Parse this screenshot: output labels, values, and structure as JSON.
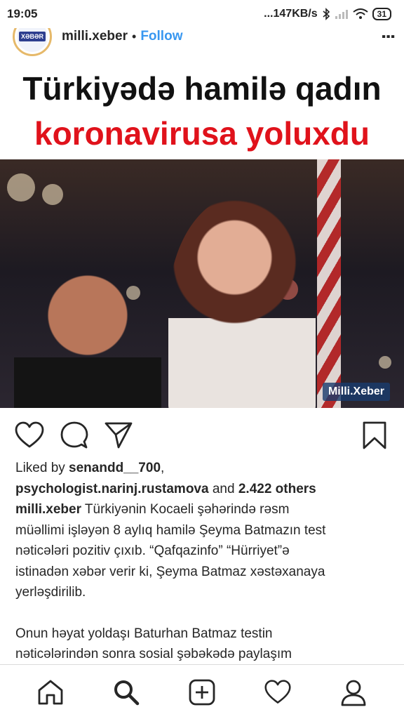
{
  "status_bar": {
    "time": "19:05",
    "network_speed": "...147KB/s",
    "battery": "31",
    "icons": [
      "bluetooth-icon",
      "signal-icon",
      "wifi-icon",
      "battery-icon"
    ]
  },
  "post": {
    "account": {
      "username": "milli.xeber",
      "separator": "•",
      "follow_label": "Follow",
      "avatar_text": "XƏBƏR"
    },
    "image": {
      "headline_line1": "Türkiyədə hamilə qadın",
      "headline_line2": "koronavirusa yoluxdu",
      "watermark": "Milli.Xeber"
    },
    "actions": {
      "icons": [
        "heart-icon",
        "comment-icon",
        "share-icon",
        "bookmark-icon"
      ]
    },
    "likes": {
      "prefix": "Liked by ",
      "user1": "senandd__700",
      "comma": ",",
      "user2": "psychologist.narinj.rustamova",
      "and": " and ",
      "others": "2.422 others"
    },
    "caption": {
      "username": "milli.xeber",
      "line1": " Türkiyənin Kocaeli şəhərində rəsm",
      "line2": "müəllimi işləyən 8 aylıq hamilə Şeyma Batmazın test",
      "line3": "nəticələri pozitiv çıxıb. “Qafqazinfo” “Hürriyet”ə",
      "line4": "istinadən xəbər verir ki, Şeyma Batmaz xəstəxanaya",
      "line5": "yerləşdirilib.",
      "line6": "Onun həyat yoldaşı Baturhan Batmaz testin",
      "line7": "nəticələrindən sonra sosial şəbəkədə paylaşım"
    }
  },
  "bottom_nav": {
    "items": [
      "home-icon",
      "search-icon",
      "add-post-icon",
      "activity-heart-icon",
      "profile-icon"
    ]
  }
}
